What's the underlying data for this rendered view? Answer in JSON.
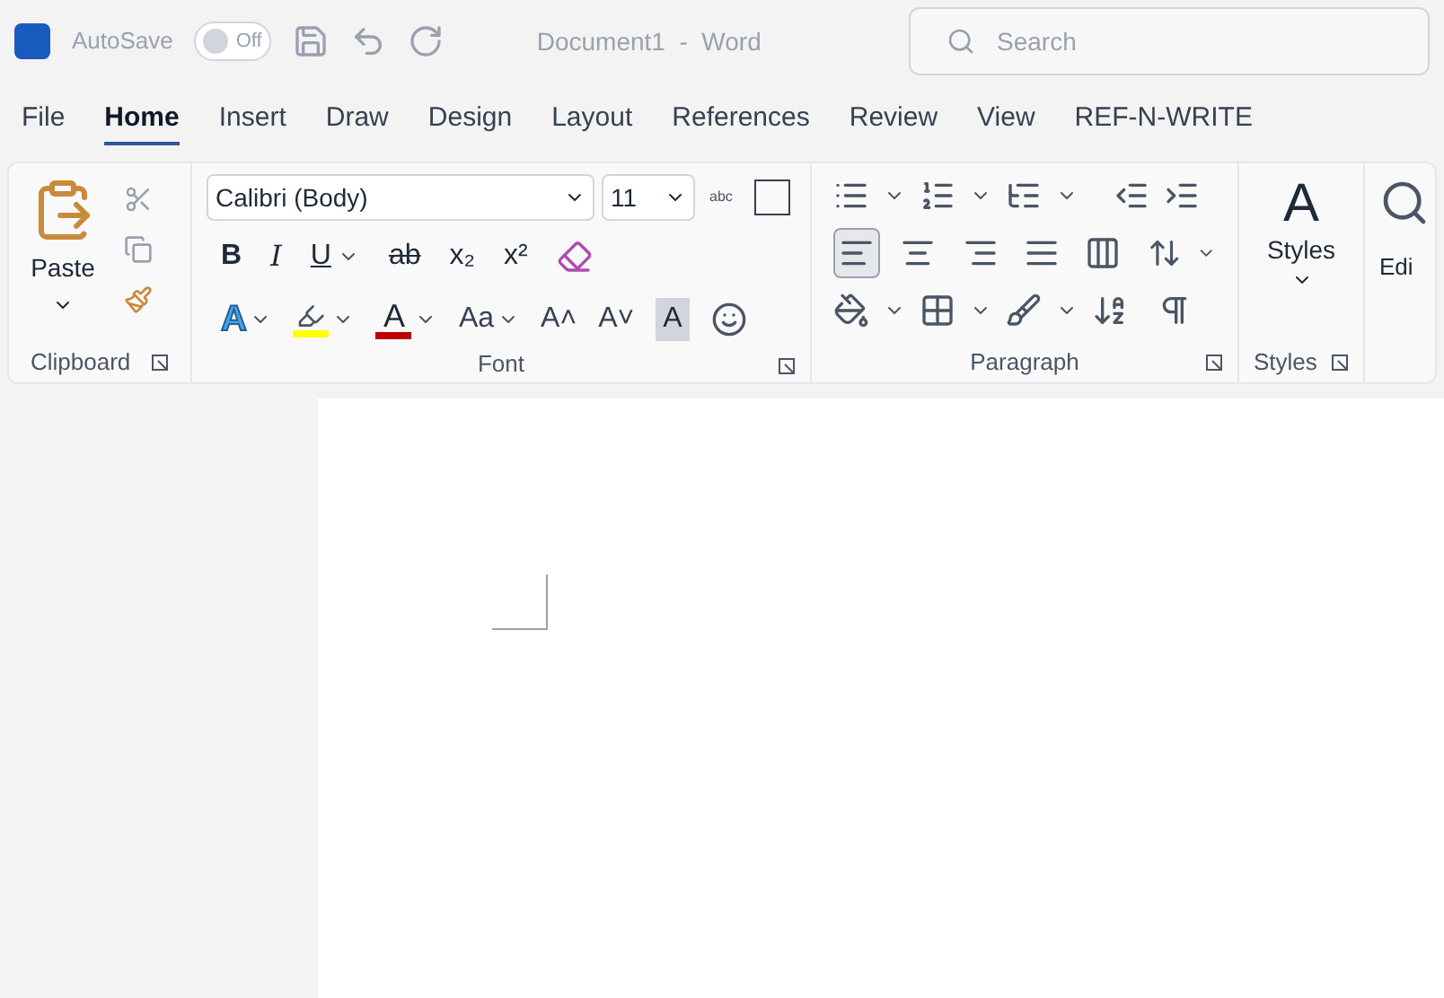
{
  "title_bar": {
    "autosave_label": "AutoSave",
    "autosave": {
      "on": false,
      "label": "Off"
    },
    "document_title": "Document1  -  Word",
    "search": {
      "placeholder": "Search"
    }
  },
  "tabs": [
    {
      "label": "File",
      "selected": false
    },
    {
      "label": "Home",
      "selected": true
    },
    {
      "label": "Insert",
      "selected": false
    },
    {
      "label": "Draw",
      "selected": false
    },
    {
      "label": "Design",
      "selected": false
    },
    {
      "label": "Layout",
      "selected": false
    },
    {
      "label": "References",
      "selected": false
    },
    {
      "label": "Review",
      "selected": false
    },
    {
      "label": "View",
      "selected": false
    },
    {
      "label": "REF-N-WRITE",
      "selected": false
    }
  ],
  "clipboard": {
    "paste_label": "Paste",
    "group_label": "Clipboard"
  },
  "font": {
    "font_name": "Calibri (Body)",
    "font_size": "11",
    "change_case_icon_text": "abc",
    "style_buttons": [
      {
        "label": "B",
        "kind": "bold",
        "dropdown": false
      },
      {
        "label": "I",
        "kind": "italic",
        "dropdown": false
      },
      {
        "label": "U",
        "kind": "underline",
        "dropdown": true
      },
      {
        "label": "ab",
        "kind": "strike",
        "dropdown": false
      },
      {
        "label": "x₂",
        "kind": "plain",
        "dropdown": false
      },
      {
        "label": "x²",
        "kind": "plain",
        "dropdown": false
      }
    ],
    "color_buttons": [
      {
        "label": "A",
        "kind": "effects",
        "dropdown": true
      },
      {
        "label": "A",
        "kind": "font-color",
        "dropdown": true
      },
      {
        "label": "Aa",
        "kind": "plain",
        "dropdown": true
      },
      {
        "label": "A˄",
        "kind": "plain",
        "dropdown": false
      },
      {
        "label": "A˅",
        "kind": "plain",
        "dropdown": false
      },
      {
        "label": "A",
        "kind": "shaded",
        "dropdown": false
      }
    ],
    "group_label": "Font"
  },
  "paragraph": {
    "alignments": [
      {
        "kind": "left",
        "selected": true
      },
      {
        "kind": "center",
        "selected": false
      },
      {
        "kind": "right",
        "selected": false
      },
      {
        "kind": "justify",
        "selected": false
      },
      {
        "kind": "distributed",
        "selected": false
      }
    ],
    "group_label": "Paragraph"
  },
  "styles": {
    "icon_text": "A",
    "label": "Styles",
    "group_label": "Styles"
  },
  "editing": {
    "label": "Edi"
  }
}
